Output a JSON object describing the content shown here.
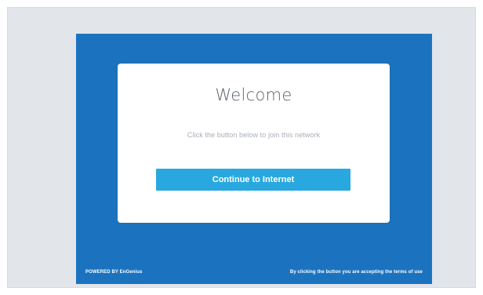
{
  "card": {
    "title": "Welcome",
    "subtitle": "Click the button below to join this network",
    "button_label": "Continue to Internet"
  },
  "footer": {
    "powered_by": "POWERED BY EnGenius",
    "terms_note": "By clicking the button you are accepting the terms of use"
  },
  "colors": {
    "page_background": "#e2e5e9",
    "portal_background": "#1b73bf",
    "button_background": "#29a8e0",
    "card_background": "#ffffff"
  }
}
